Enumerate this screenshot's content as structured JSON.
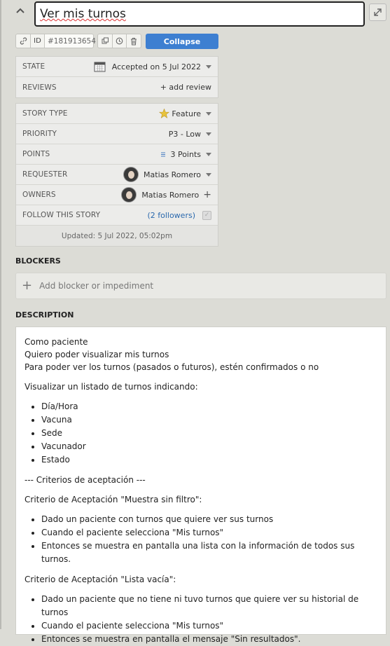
{
  "story": {
    "title": "Ver mis turnos",
    "id_label": "ID",
    "id_value": "#181913654",
    "collapse_label": "Collapse"
  },
  "meta": {
    "state": {
      "label": "STATE",
      "value": "Accepted on 5 Jul 2022"
    },
    "reviews": {
      "label": "REVIEWS",
      "action": "+ add review"
    }
  },
  "details": {
    "story_type": {
      "label": "STORY TYPE",
      "value": "Feature"
    },
    "priority": {
      "label": "PRIORITY",
      "value": "P3 - Low"
    },
    "points": {
      "label": "POINTS",
      "value": "3 Points"
    },
    "requester": {
      "label": "REQUESTER",
      "value": "Matias Romero"
    },
    "owners": {
      "label": "OWNERS",
      "value": "Matias Romero"
    },
    "follow": {
      "label": "FOLLOW THIS STORY",
      "value": "(2 followers)"
    },
    "updated": "Updated: 5 Jul 2022, 05:02pm"
  },
  "blockers": {
    "heading": "BLOCKERS",
    "placeholder": "Add blocker or impediment"
  },
  "description": {
    "heading": "DESCRIPTION",
    "intro": [
      "Como paciente",
      "Quiero poder visualizar mis turnos",
      "Para poder ver los turnos (pasados o futuros), estén confirmados o no"
    ],
    "list_intro": "Visualizar un listado de turnos indicando:",
    "list": [
      "Día/Hora",
      "Vacuna",
      "Sede",
      "Vacunador",
      "Estado"
    ],
    "criteria_header": "--- Criterios de aceptación ---",
    "criterion1_title": "Criterio de Aceptación \"Muestra sin filtro\":",
    "criterion1": [
      "Dado un paciente con turnos que quiere ver sus turnos",
      "Cuando el paciente selecciona \"Mis turnos\"",
      "Entonces se muestra en pantalla una lista con la información de todos sus turnos."
    ],
    "criterion2_title": "Criterio de Aceptación \"Lista vacía\":",
    "criterion2": [
      "Dado un paciente que no tiene ni tuvo turnos que quiere ver su historial de turnos",
      "Cuando el paciente selecciona \"Mis turnos\"",
      "Entonces se muestra en pantalla el mensaje \"Sin resultados\"."
    ]
  }
}
